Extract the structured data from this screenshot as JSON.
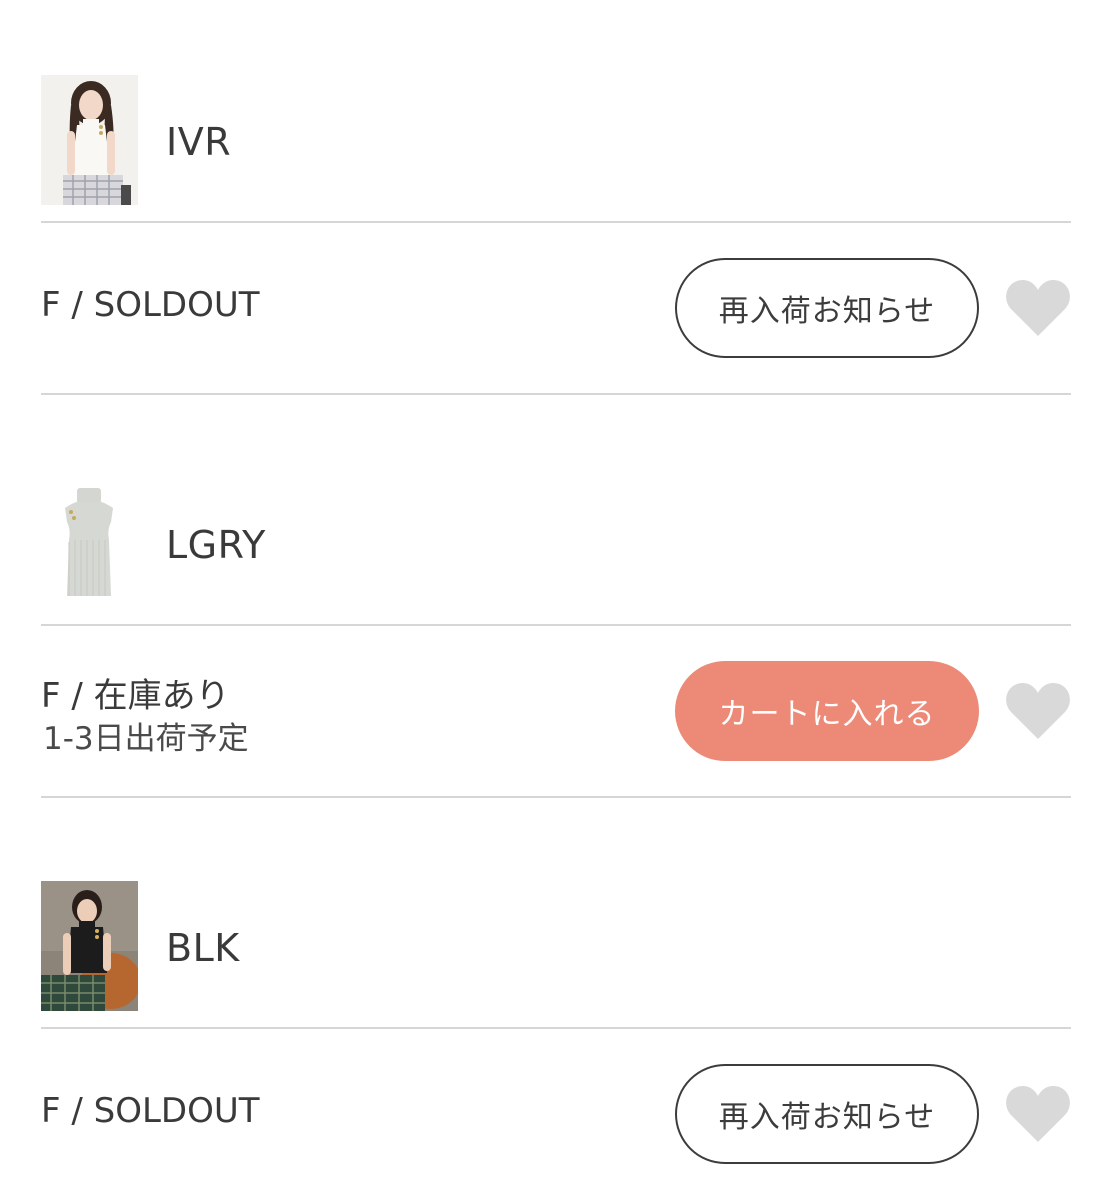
{
  "variants": [
    {
      "color_name": "IVR",
      "thumbnail": "model-ivory-turtleneck-photo",
      "size_status": "F / SOLDOUT",
      "ship_note": "",
      "action_label": "再入荷お知らせ",
      "action_type": "restock-notify",
      "favorite_icon": "heart-icon"
    },
    {
      "color_name": "LGRY",
      "thumbnail": "light-gray-sleeveless-knit-product-photo",
      "size_status": "F / 在庫あり",
      "ship_note": "1-3日出荷予定",
      "action_label": "カートに入れる",
      "action_type": "add-to-cart",
      "favorite_icon": "heart-icon"
    },
    {
      "color_name": "BLK",
      "thumbnail": "model-black-turtleneck-photo",
      "size_status": "F / SOLDOUT",
      "ship_note": "",
      "action_label": "再入荷お知らせ",
      "action_type": "restock-notify",
      "favorite_icon": "heart-icon"
    }
  ],
  "colors": {
    "cart_button": "#ec8a77",
    "divider": "#d6d6d6",
    "heart": "#d9d9d9",
    "text": "#3a3a3a"
  }
}
